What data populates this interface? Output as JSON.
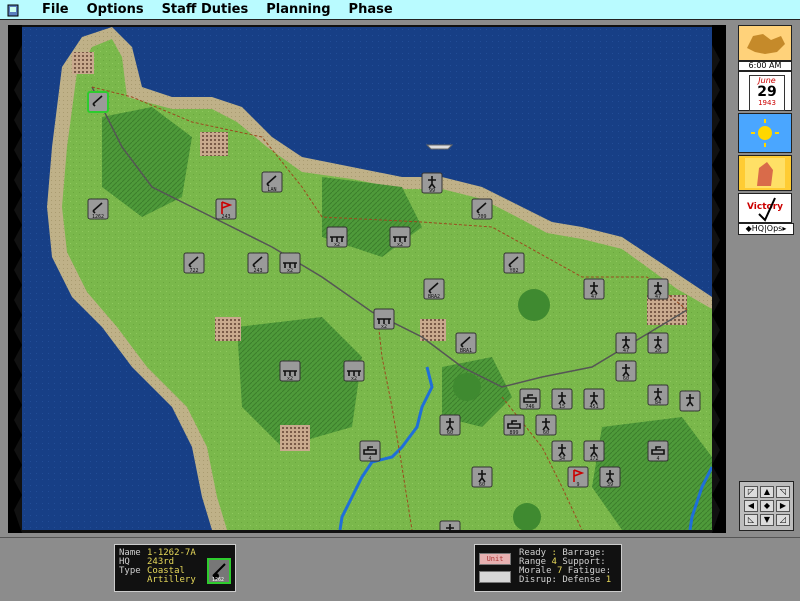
{
  "menu": {
    "items": [
      "File",
      "Options",
      "Staff Duties",
      "Planning",
      "Phase"
    ]
  },
  "side_panel": {
    "time": "6:00 AM",
    "date_month": "June",
    "date_day": "29",
    "date_year": "1943",
    "victory_label": "Victory",
    "hqops_label": "◆HQ|Ops▸"
  },
  "map": {
    "units": [
      {
        "label": "",
        "type": "artillery"
      },
      {
        "label": "1262",
        "type": "artillery"
      },
      {
        "label": "243",
        "type": "flag"
      },
      {
        "label": "LAN",
        "type": "artillery"
      },
      {
        "label": "99",
        "type": "infantry"
      },
      {
        "label": "709",
        "type": "artillery"
      },
      {
        "label": "x2",
        "type": "fort"
      },
      {
        "label": "x2",
        "type": "fort"
      },
      {
        "label": "722",
        "type": "artillery"
      },
      {
        "label": "243",
        "type": "artillery"
      },
      {
        "label": "x2",
        "type": "fort"
      },
      {
        "label": "BRA2",
        "type": "artillery"
      },
      {
        "label": "Y02",
        "type": "artillery"
      },
      {
        "label": "47",
        "type": "infantry"
      },
      {
        "label": "47",
        "type": "infantry"
      },
      {
        "label": "x2",
        "type": "fort"
      },
      {
        "label": "BRA1",
        "type": "artillery"
      },
      {
        "label": "47",
        "type": "infantry"
      },
      {
        "label": "26",
        "type": "infantry"
      },
      {
        "label": "x2",
        "type": "fort"
      },
      {
        "label": "x2",
        "type": "fort"
      },
      {
        "label": "60",
        "type": "infantry"
      },
      {
        "label": "84",
        "type": "infantry"
      },
      {
        "label": "746",
        "type": "armor"
      },
      {
        "label": "15",
        "type": "infantry"
      },
      {
        "label": "451",
        "type": "infantry"
      },
      {
        "label": "60",
        "type": "infantry"
      },
      {
        "label": "899",
        "type": "armor"
      },
      {
        "label": "60",
        "type": "infantry"
      },
      {
        "label": "4",
        "type": "armor"
      },
      {
        "label": "34",
        "type": "infantry"
      },
      {
        "label": "172",
        "type": "infantry"
      },
      {
        "label": "60",
        "type": "infantry"
      },
      {
        "label": "9",
        "type": "flag"
      },
      {
        "label": "39",
        "type": "infantry"
      },
      {
        "label": "4",
        "type": "armor"
      },
      {
        "label": "",
        "type": "infantry"
      },
      {
        "label": "",
        "type": "infantry"
      }
    ]
  },
  "unit_info": {
    "name_label": "Name",
    "name_value": "1-1262-7A",
    "hq_label": "HQ",
    "hq_value": "243rd",
    "type_label": "Type",
    "type_value_1": "Coastal",
    "type_value_2": "Artillery",
    "unit_button_label": "Unit"
  },
  "stats": {
    "ready_label": "Ready",
    "ready_value": ":",
    "barrage_label": "Barrage:",
    "range_label": "Range",
    "range_value": "4",
    "support_label": "Support:",
    "morale_label": "Morale",
    "morale_value": "7",
    "fatigue_label": "Fatigue:",
    "disrup_label": "Disrup:",
    "defense_label": "Defense",
    "defense_value": "1"
  },
  "colors": {
    "sea": "#173f86",
    "grass": "#7ab84b",
    "forest": "#4e9a3a",
    "beach": "#bfb188",
    "menubar": "#b9fbff",
    "unit_selected": "#2ecc2e"
  }
}
